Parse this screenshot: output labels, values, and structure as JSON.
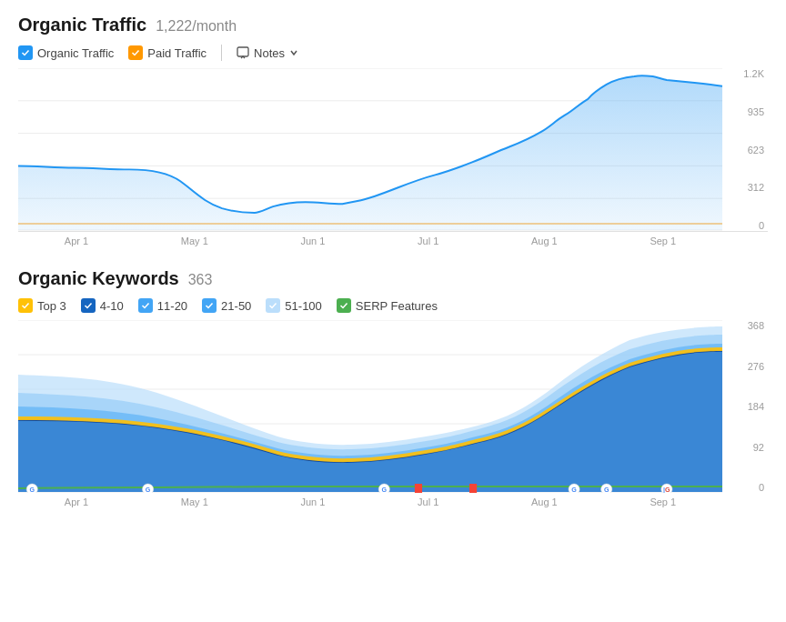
{
  "organic_traffic": {
    "title": "Organic Traffic",
    "subtitle": "1,222/month",
    "legend": [
      {
        "id": "organic",
        "label": "Organic Traffic",
        "color_class": "cb-blue",
        "checked": true
      },
      {
        "id": "paid",
        "label": "Paid Traffic",
        "color_class": "cb-orange",
        "checked": true
      }
    ],
    "notes_label": "Notes",
    "y_axis": [
      "1.2K",
      "935",
      "623",
      "312",
      "0"
    ],
    "x_axis": [
      "Apr 1",
      "May 1",
      "Jun 1",
      "Jul 1",
      "Aug 1",
      "Sep 1"
    ]
  },
  "organic_keywords": {
    "title": "Organic Keywords",
    "subtitle": "363",
    "legend": [
      {
        "id": "top3",
        "label": "Top 3",
        "color_class": "cb-yellow",
        "checked": true
      },
      {
        "id": "4-10",
        "label": "4-10",
        "color_class": "cb-darkblue",
        "checked": true
      },
      {
        "id": "11-20",
        "label": "11-20",
        "color_class": "cb-medblue",
        "checked": true
      },
      {
        "id": "21-50",
        "label": "21-50",
        "color_class": "cb-lightblue",
        "checked": true
      },
      {
        "id": "51-100",
        "label": "51-100",
        "color_class": "cb-paleblue",
        "checked": true
      },
      {
        "id": "serp",
        "label": "SERP Features",
        "color_class": "cb-green",
        "checked": true
      }
    ],
    "y_axis": [
      "368",
      "276",
      "184",
      "92",
      "0"
    ],
    "x_axis": [
      "Apr 1",
      "May 1",
      "Jun 1",
      "Jul 1",
      "Aug 1",
      "Sep 1"
    ]
  }
}
